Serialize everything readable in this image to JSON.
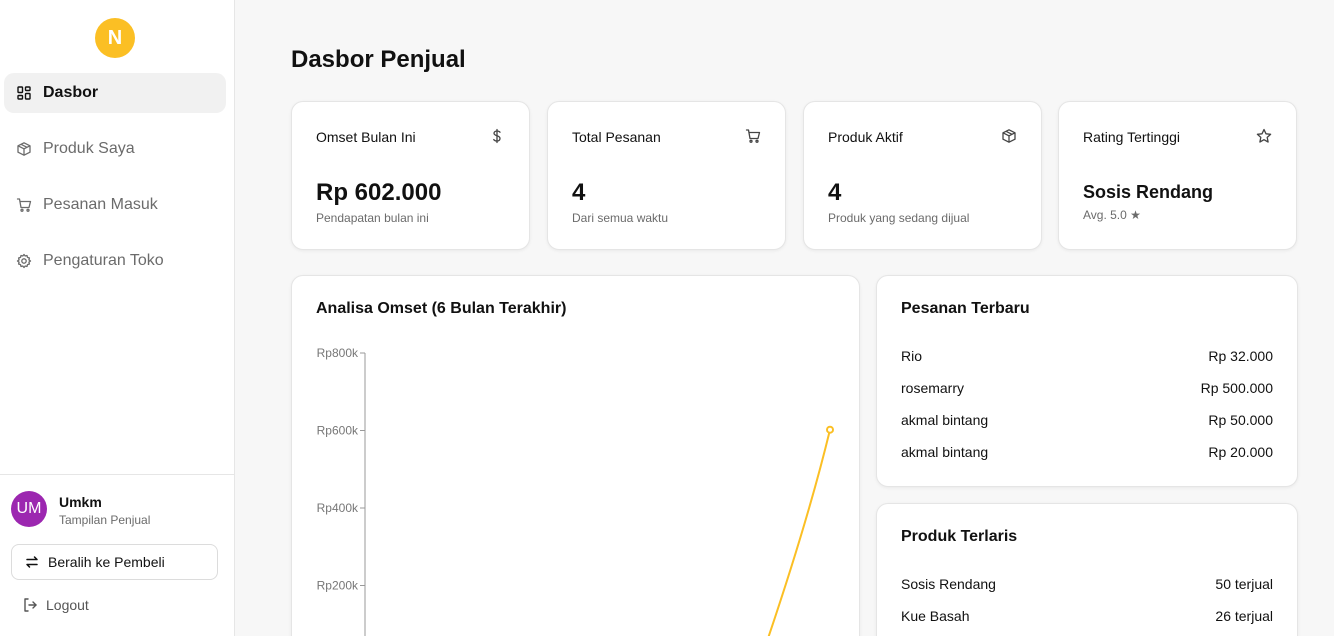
{
  "sidebar": {
    "logo_letter": "N",
    "items": [
      {
        "label": "Dasbor",
        "icon": "dashboard-icon",
        "active": true
      },
      {
        "label": "Produk Saya",
        "icon": "box-icon",
        "active": false
      },
      {
        "label": "Pesanan Masuk",
        "icon": "cart-icon",
        "active": false
      },
      {
        "label": "Pengaturan Toko",
        "icon": "gear-icon",
        "active": false
      }
    ],
    "user": {
      "initials": "UM",
      "name": "Umkm",
      "role": "Tampilan Penjual"
    },
    "switch_label": "Beralih ke Pembeli",
    "logout_label": "Logout"
  },
  "main": {
    "title": "Dasbor Penjual",
    "stats": [
      {
        "label": "Omset Bulan Ini",
        "icon": "dollar-icon",
        "value": "Rp 602.000",
        "sub": "Pendapatan bulan ini"
      },
      {
        "label": "Total Pesanan",
        "icon": "cart-icon",
        "value": "4",
        "sub": "Dari semua waktu"
      },
      {
        "label": "Produk Aktif",
        "icon": "box-icon",
        "value": "4",
        "sub": "Produk yang sedang dijual"
      },
      {
        "label": "Rating Tertinggi",
        "icon": "star-icon",
        "value": "Sosis Rendang",
        "sub": "Avg. 5.0 ★"
      }
    ],
    "chart_title": "Analisa Omset (6 Bulan Terakhir)",
    "orders_title": "Pesanan Terbaru",
    "orders": [
      {
        "name": "Rio",
        "amount": "Rp 32.000"
      },
      {
        "name": "rosemarry",
        "amount": "Rp 500.000"
      },
      {
        "name": "akmal bintang",
        "amount": "Rp 50.000"
      },
      {
        "name": "akmal bintang",
        "amount": "Rp 20.000"
      }
    ],
    "best_title": "Produk Terlaris",
    "best": [
      {
        "name": "Sosis Rendang",
        "sold": "50 terjual"
      },
      {
        "name": "Kue Basah",
        "sold": "26 terjual"
      }
    ]
  },
  "colors": {
    "accent": "#fbbf24",
    "line": "#fbbf24",
    "avatar": "#9c27b0"
  },
  "chart_data": {
    "type": "line",
    "title": "Analisa Omset (6 Bulan Terakhir)",
    "y_tick_labels": [
      "Rp800k",
      "Rp600k",
      "Rp400k",
      "Rp200k"
    ],
    "y_ticks": [
      800000,
      600000,
      400000,
      200000
    ],
    "ylim": [
      0,
      800000
    ],
    "visible_points": [
      {
        "y": 602000
      }
    ],
    "grid": false
  }
}
